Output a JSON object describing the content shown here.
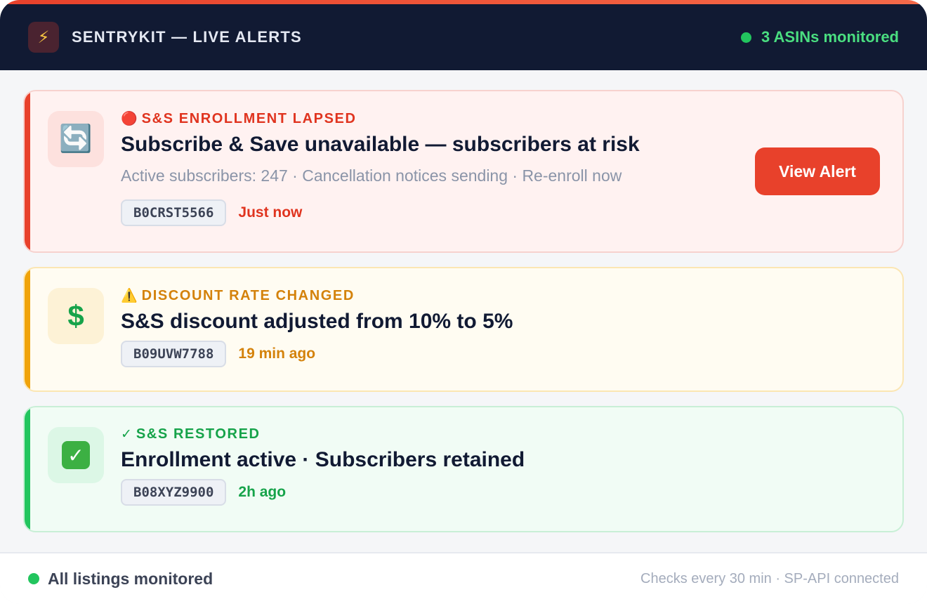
{
  "header": {
    "logo_icon": "lightning-bolt-icon",
    "logo_glyph": "⚡",
    "title": "SENTRYKIT — LIVE ALERTS",
    "monitor_status": "3 ASINs monitored"
  },
  "alerts": [
    {
      "severity": "critical",
      "icon": "refresh-arrows-icon",
      "icon_glyph": "🔄",
      "tag_icon": "red-circle-icon",
      "tag_glyph": "🔴",
      "tag": "S&S ENROLLMENT LAPSED",
      "headline": "Subscribe & Save unavailable — subscribers at risk",
      "detail": "Active subscribers: 247 · Cancellation notices sending · Re-enroll now",
      "asin": "B0CRST5566",
      "time": "Just now",
      "action_label": "View Alert"
    },
    {
      "severity": "warning",
      "icon": "dollar-sign-icon",
      "icon_glyph": "$",
      "tag_icon": "warning-icon",
      "tag_glyph": "⚠️",
      "tag": "DISCOUNT RATE CHANGED",
      "headline": "S&S discount adjusted from 10% to 5%",
      "asin": "B09UVW7788",
      "time": "19 min ago"
    },
    {
      "severity": "success",
      "icon": "check-box-icon",
      "icon_glyph": "✓",
      "tag_icon": "checkmark-icon",
      "tag_glyph": "✓",
      "tag": "S&S RESTORED",
      "headline": "Enrollment active · Subscribers retained",
      "asin": "B08XYZ9900",
      "time": "2h ago"
    }
  ],
  "footer": {
    "status": "All listings monitored",
    "info": "Checks every 30 min · SP-API connected"
  },
  "colors": {
    "critical": "#e8412b",
    "warning": "#f0a30a",
    "success": "#22c55e",
    "header_bg": "#111a33"
  }
}
